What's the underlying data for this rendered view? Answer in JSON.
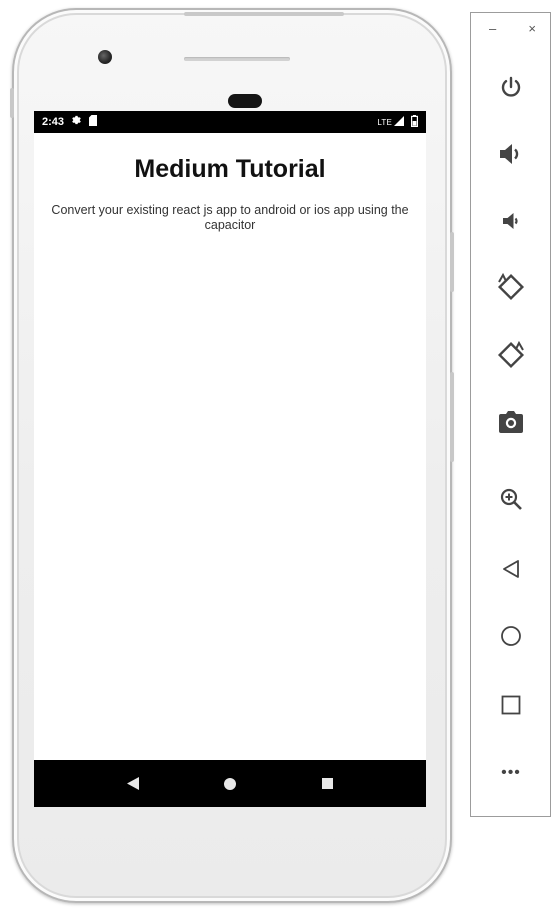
{
  "status_bar": {
    "time": "2:43",
    "network": "LTE",
    "icons": [
      "settings-icon",
      "sim-card-icon",
      "signal-icon",
      "battery-icon"
    ]
  },
  "app": {
    "title": "Medium Tutorial",
    "description": "Convert your existing react js app to android or ios app using the capacitor"
  },
  "nav_bar": {
    "buttons": [
      "back-triangle-icon",
      "home-circle-icon",
      "overview-square-icon"
    ]
  },
  "emulator_toolbar": {
    "minimize_label": "–",
    "close_label": "×",
    "tools": [
      "power-icon",
      "volume-up-icon",
      "volume-down-icon",
      "rotate-left-icon",
      "rotate-right-icon",
      "camera-icon",
      "zoom-icon",
      "back-icon",
      "home-icon",
      "overview-icon",
      "more-icon"
    ],
    "more_label": "•••"
  },
  "colors": {
    "status_bar": "#000000",
    "nav_bar": "#000000",
    "screen_bg": "#ffffff",
    "icon_color": "#444444",
    "phone_body": "#efefef"
  }
}
